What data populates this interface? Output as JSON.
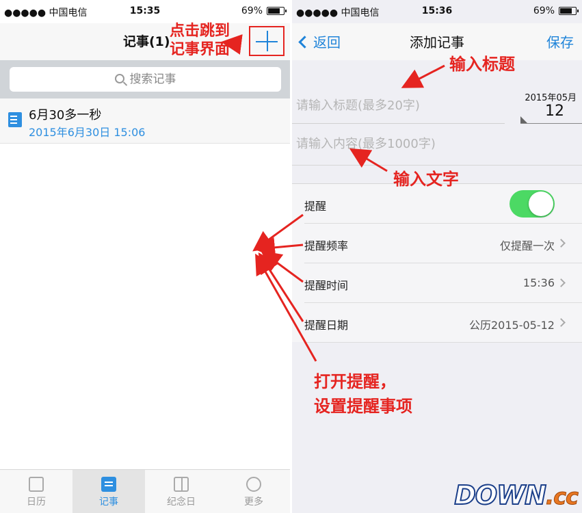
{
  "left": {
    "status": {
      "carrier": "●●●●● 中国电信",
      "time": "15:35",
      "battery": "69%"
    },
    "nav_title": "记事(1)",
    "annotation_jump": [
      "点击跳到",
      "记事界面"
    ],
    "search_placeholder": "搜索记事",
    "note": {
      "title": "6月30多一秒",
      "date": "2015年6月30日 15:06"
    },
    "tabs": [
      {
        "label": "日历",
        "icon": "calendar-icon"
      },
      {
        "label": "记事",
        "icon": "note-icon"
      },
      {
        "label": "纪念日",
        "icon": "gift-icon"
      },
      {
        "label": "更多",
        "icon": "more-icon"
      }
    ],
    "active_tab": "记事"
  },
  "right": {
    "status": {
      "carrier": "●●●●● 中国电信",
      "time": "15:36",
      "battery": "69%"
    },
    "back_label": "返回",
    "nav_title": "添加记事",
    "save_label": "保存",
    "title_placeholder": "请输入标题(最多20字)",
    "content_placeholder": "请输入内容(最多1000字)",
    "date_month": "2015年05月",
    "date_day": "12",
    "rows": [
      {
        "label": "提醒",
        "value": "",
        "toggle": true
      },
      {
        "label": "提醒频率",
        "value": "仅提醒一次"
      },
      {
        "label": "提醒时间",
        "value": "15:36"
      },
      {
        "label": "提醒日期",
        "value": "公历2015-05-12"
      }
    ],
    "annotation_title": "输入标题",
    "annotation_text": "输入文字",
    "annotation_remind": [
      "打开提醒，",
      "设置提醒事项"
    ]
  },
  "logo": {
    "main": "DOWN",
    "suffix": ".cc"
  },
  "colors": {
    "accent": "#1f84d9",
    "annotation": "#e52420",
    "toggle_on": "#4cd964"
  }
}
